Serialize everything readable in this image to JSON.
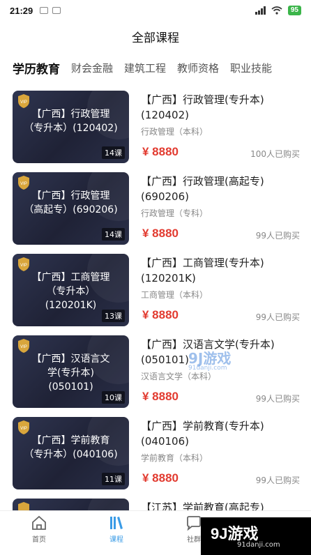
{
  "status": {
    "time": "21:29",
    "battery": "95"
  },
  "page_title": "全部课程",
  "tabs": [
    {
      "label": "学历教育",
      "active": true
    },
    {
      "label": "财会金融"
    },
    {
      "label": "建筑工程"
    },
    {
      "label": "教师资格"
    },
    {
      "label": "职业技能"
    }
  ],
  "courses": [
    {
      "thumb": "【广西】行政管理\n（专升本）(120402)",
      "lessons": "14课",
      "title": "【广西】行政管理(专升本)(120402)",
      "sub": "行政管理（本科）",
      "price": "¥ 8880",
      "buyers": "100人已购买"
    },
    {
      "thumb": "【广西】行政管理\n（高起专）(690206)",
      "lessons": "14课",
      "title": "【广西】行政管理(高起专)(690206)",
      "sub": "行政管理（专科）",
      "price": "¥ 8880",
      "buyers": "99人已购买"
    },
    {
      "thumb": "【广西】工商管理\n（专升本）\n(120201K)",
      "lessons": "13课",
      "title": "【广西】工商管理(专升本)(120201K)",
      "sub": "工商管理（本科）",
      "price": "¥ 8880",
      "buyers": "99人已购买"
    },
    {
      "thumb": "【广西】汉语言文\n学(专升本)\n(050101)",
      "lessons": "10课",
      "title": "【广西】汉语言文学(专升本)(050101)",
      "sub": "汉语言文学（本科）",
      "price": "¥ 8880",
      "buyers": "99人已购买"
    },
    {
      "thumb": "【广西】学前教育\n（专升本）(040106)",
      "lessons": "11课",
      "title": "【广西】学前教育(专升本)(040106)",
      "sub": "学前教育（本科）",
      "price": "¥ 8880",
      "buyers": "99人已购买"
    },
    {
      "thumb": "",
      "lessons": "",
      "title": "【江苏】学前教育(高起专)",
      "sub": "",
      "price": "",
      "buyers": ""
    }
  ],
  "tabbar": [
    {
      "label": "首页",
      "icon": "home-icon"
    },
    {
      "label": "课程",
      "icon": "books-icon",
      "active": true
    },
    {
      "label": "社群",
      "icon": "chat-icon"
    }
  ],
  "watermark": {
    "logo": "9J游戏",
    "url": "91danji.com",
    "mid": "9J游戏",
    "mid_url": "91danji.com"
  },
  "colors": {
    "accent": "#3a9be6",
    "price": "#e23b30",
    "thumb_bg": "#23273b"
  }
}
